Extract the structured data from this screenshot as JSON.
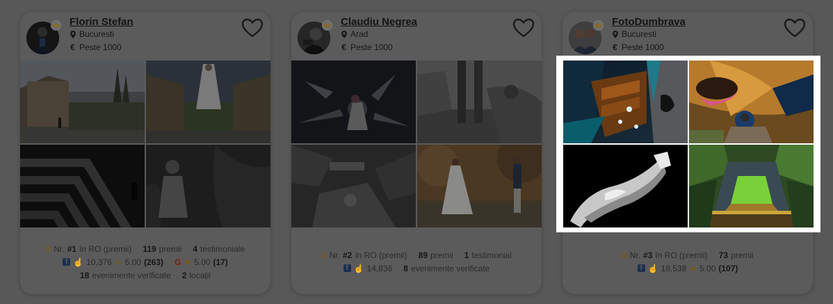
{
  "cards": [
    {
      "name": "Florin Stefan",
      "location": "Bucuresti",
      "price": "Peste 1000",
      "rank": {
        "prefix": "Nr.",
        "number": "#1",
        "suffix": "în RO (premii)"
      },
      "awards": {
        "value": "119",
        "label": "premii"
      },
      "testimonials": {
        "value": "4",
        "label": "testimoniale"
      },
      "facebook": {
        "likes": "10,376",
        "rating": "5.00",
        "count": "(263)"
      },
      "google": {
        "rating": "5.00",
        "count": "(17)"
      },
      "events": {
        "value": "18",
        "label": "evenimente verificate"
      },
      "locations": {
        "value": "2",
        "label": "locații"
      }
    },
    {
      "name": "Claudiu Negrea",
      "location": "Arad",
      "price": "Peste 1000",
      "rank": {
        "prefix": "Nr.",
        "number": "#2",
        "suffix": "în RO (premii)"
      },
      "awards": {
        "value": "89",
        "label": "premii"
      },
      "testimonials": {
        "value": "1",
        "label": "testimonial"
      },
      "facebook": {
        "likes": "14,836"
      },
      "events": {
        "value": "8",
        "label": "evenimente verificate"
      }
    },
    {
      "name": "FotoDumbrava",
      "location": "Bucuresti",
      "price": "Peste 1000",
      "rank": {
        "prefix": "Nr.",
        "number": "#3",
        "suffix": "în RO (premii)"
      },
      "awards": {
        "value": "73",
        "label": "premii"
      },
      "facebook": {
        "likes": "18,538",
        "rating": "5.00",
        "count": "(107)"
      }
    }
  ],
  "icons": {
    "location": "map-pin-icon",
    "price": "euro-icon",
    "favorite": "heart-icon",
    "badge": "crown-icon",
    "medal": "medal-icon",
    "facebook": "facebook-icon",
    "google": "google-icon",
    "like": "thumbs-up-icon",
    "star": "star-icon"
  },
  "colors": {
    "overlay": "#585858",
    "highlight": "#ffffff",
    "gold": "#c8952a"
  }
}
